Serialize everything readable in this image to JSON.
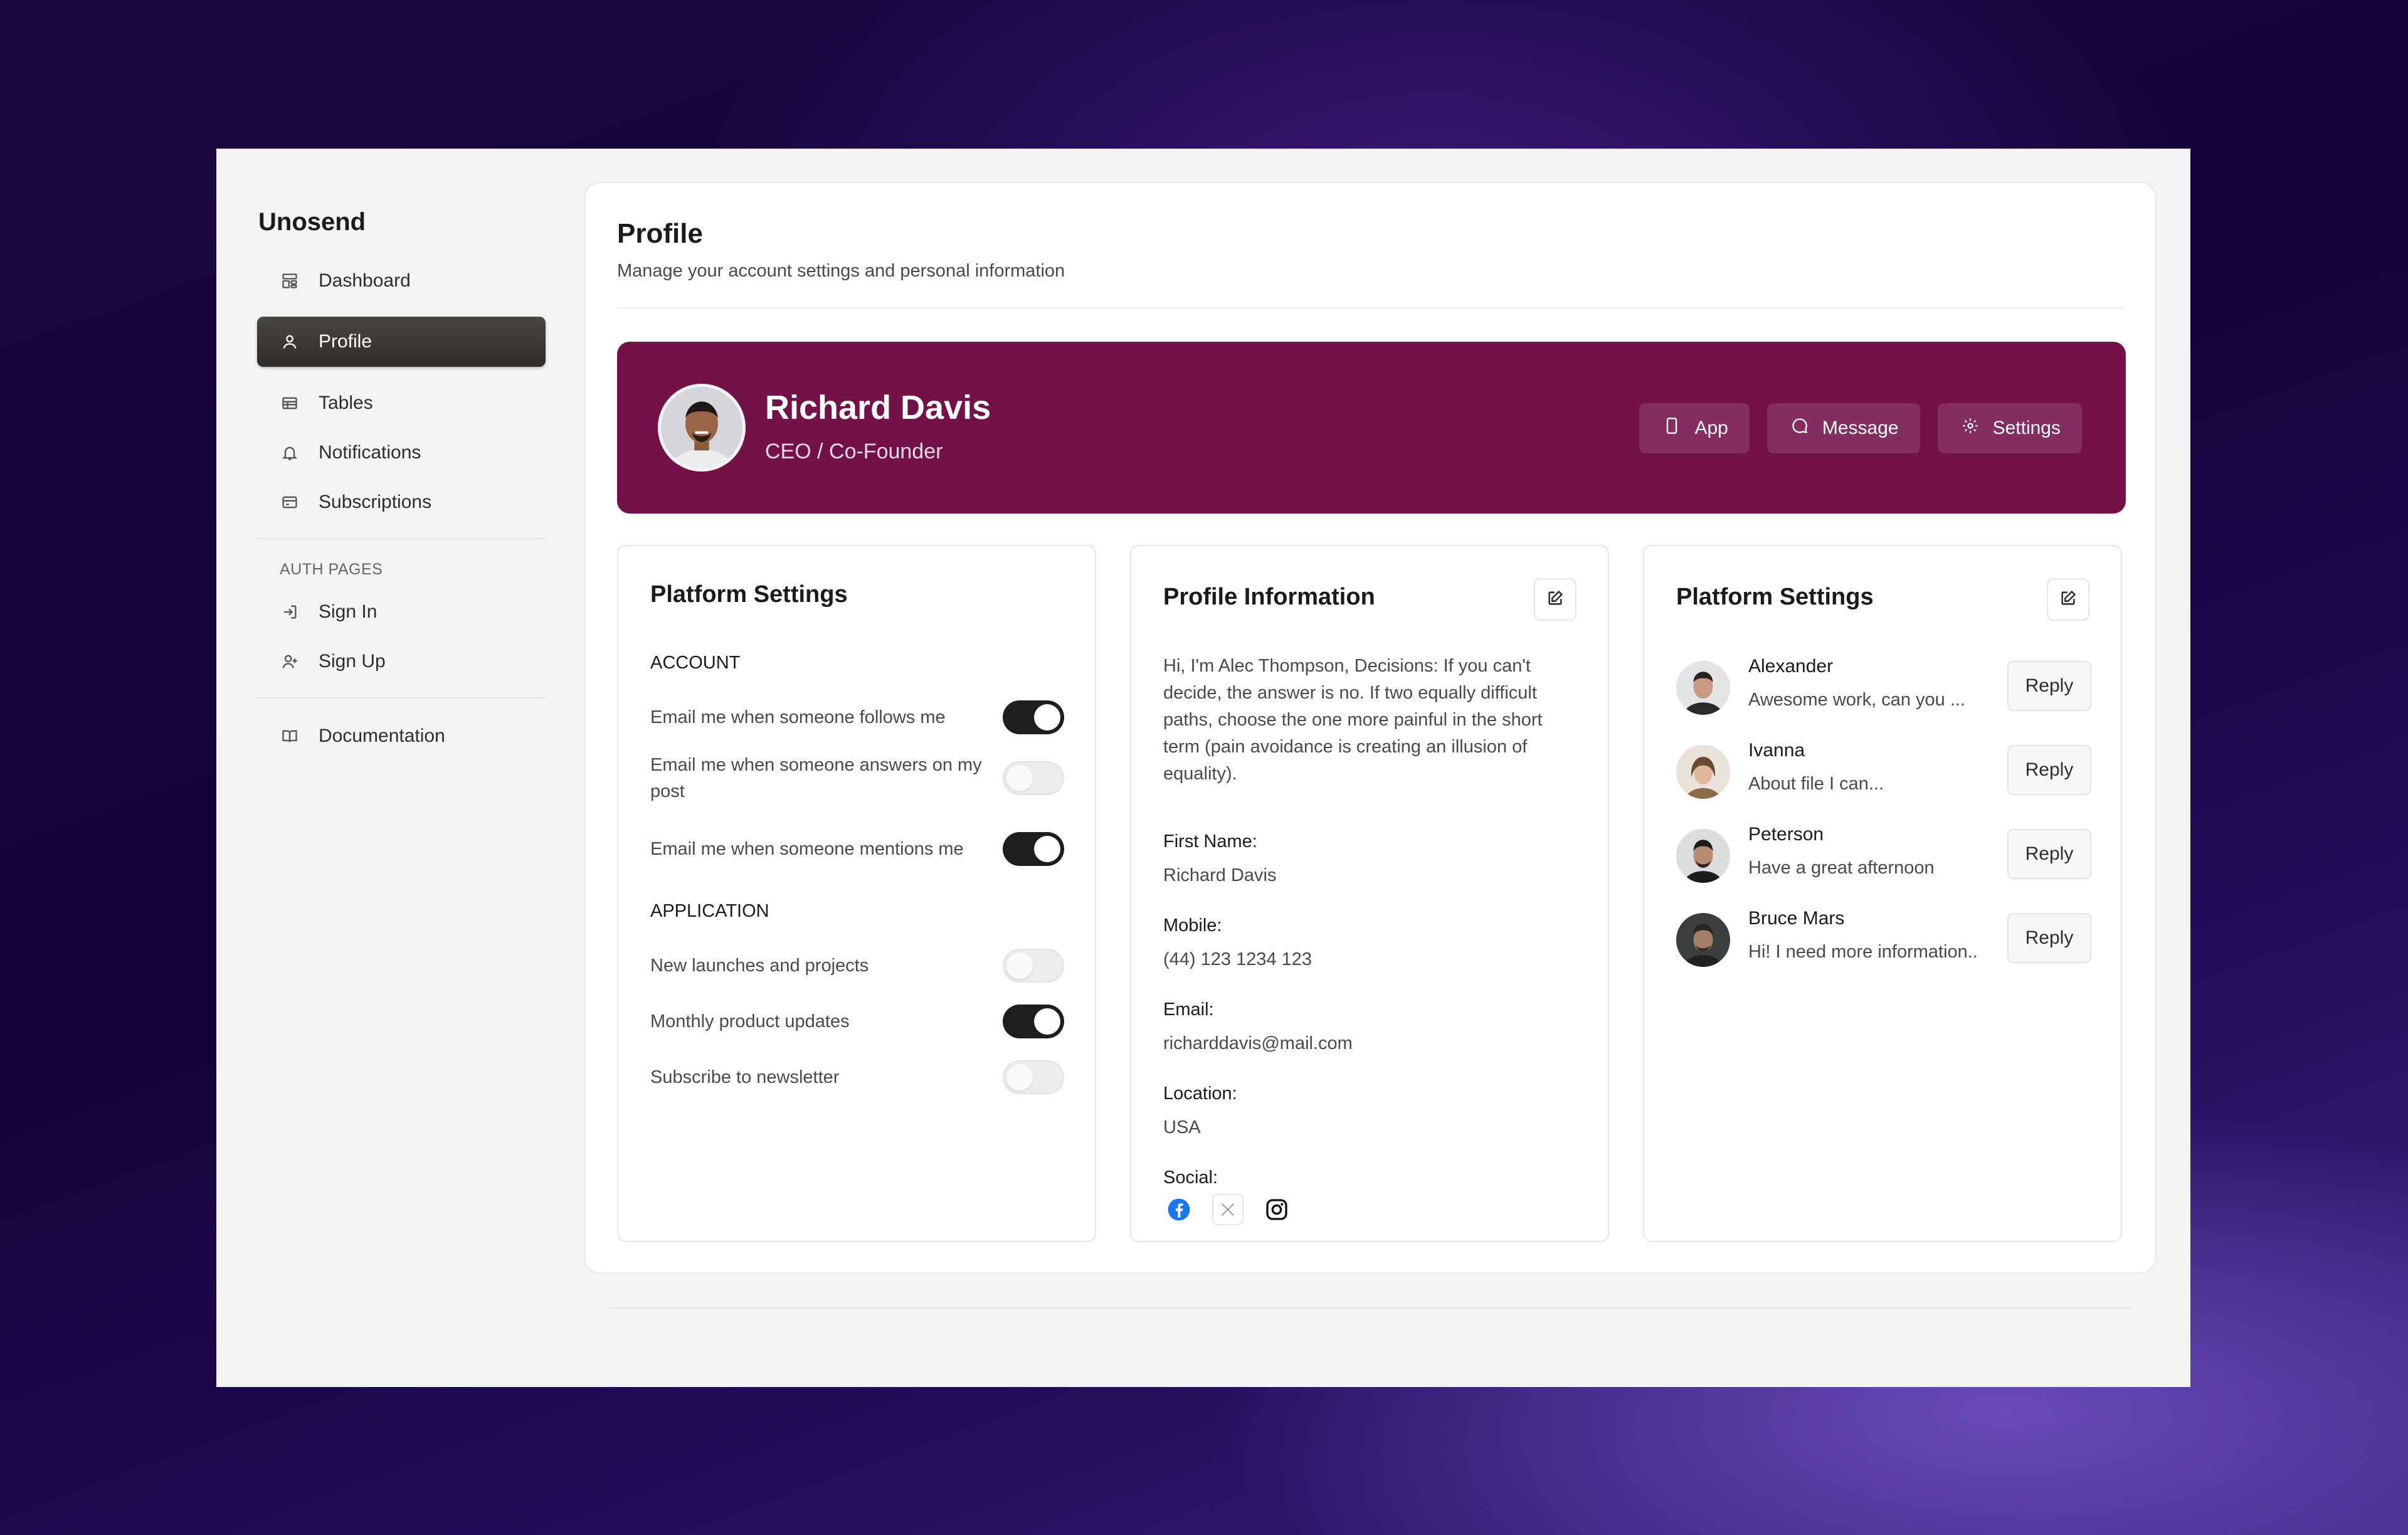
{
  "sidebar": {
    "brand": "Unosend",
    "items": [
      {
        "label": "Dashboard",
        "icon": "dashboard-icon"
      },
      {
        "label": "Profile",
        "icon": "user-icon",
        "active": true
      },
      {
        "label": "Tables",
        "icon": "table-icon"
      },
      {
        "label": "Notifications",
        "icon": "bell-icon"
      },
      {
        "label": "Subscriptions",
        "icon": "credit-card-icon"
      }
    ],
    "auth_label": "AUTH PAGES",
    "auth_items": [
      {
        "label": "Sign In",
        "icon": "sign-in-icon"
      },
      {
        "label": "Sign Up",
        "icon": "user-plus-icon"
      }
    ],
    "docs": {
      "label": "Documentation",
      "icon": "book-icon"
    }
  },
  "header": {
    "title": "Profile",
    "subtitle": "Manage your account settings and personal information"
  },
  "banner": {
    "name": "Richard Davis",
    "role": "CEO / Co-Founder",
    "background": "#731249",
    "actions": [
      {
        "label": "App",
        "icon": "phone-icon"
      },
      {
        "label": "Message",
        "icon": "chat-icon"
      },
      {
        "label": "Settings",
        "icon": "gear-icon"
      }
    ]
  },
  "platform_settings": {
    "title": "Platform Settings",
    "account_label": "ACCOUNT",
    "account": [
      {
        "label": "Email me when someone follows me",
        "on": true
      },
      {
        "label": "Email me when someone answers on my post",
        "on": false
      },
      {
        "label": "Email me when someone mentions me",
        "on": true
      }
    ],
    "application_label": "APPLICATION",
    "application": [
      {
        "label": "New launches and projects",
        "on": false
      },
      {
        "label": "Monthly product updates",
        "on": true
      },
      {
        "label": "Subscribe to newsletter",
        "on": false
      }
    ]
  },
  "profile_info": {
    "title": "Profile Information",
    "bio": "Hi, I'm Alec Thompson, Decisions: If you can't decide, the answer is no. If two equally difficult paths, choose the one more painful in the short term (pain avoidance is creating an illusion of equality).",
    "fields": [
      {
        "label": "First Name:",
        "value": "Richard Davis"
      },
      {
        "label": "Mobile:",
        "value": "(44) 123 1234 123"
      },
      {
        "label": "Email:",
        "value": "richarddavis@mail.com"
      },
      {
        "label": "Location:",
        "value": "USA"
      }
    ],
    "social_label": "Social:",
    "socials": [
      "facebook-icon",
      "x-icon",
      "instagram-icon"
    ]
  },
  "conversations": {
    "title": "Platform Settings",
    "reply_label": "Reply",
    "items": [
      {
        "name": "Alexander",
        "text": "Awesome work, can you ..."
      },
      {
        "name": "Ivanna",
        "text": "About file I can..."
      },
      {
        "name": "Peterson",
        "text": "Have a great afternoon"
      },
      {
        "name": "Bruce Mars",
        "text": "Hi! I need more information.."
      }
    ]
  }
}
